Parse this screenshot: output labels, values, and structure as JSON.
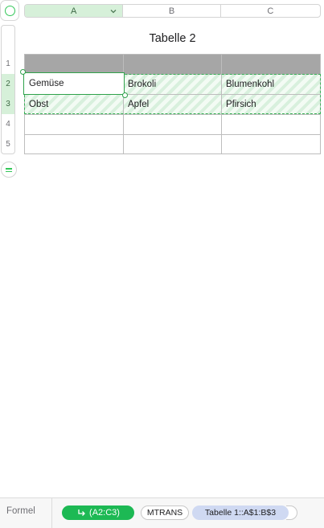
{
  "columns": [
    {
      "label": "A",
      "selected": true
    },
    {
      "label": "B",
      "selected": false
    },
    {
      "label": "C",
      "selected": false
    }
  ],
  "rows": [
    "1",
    "2",
    "3",
    "4",
    "5"
  ],
  "selected_rows": [
    "2",
    "3"
  ],
  "table_title": "Tabelle 2",
  "cells": [
    [
      "",
      "",
      ""
    ],
    [
      "Gemüse",
      "Brokoli",
      "Blumenkohl"
    ],
    [
      "Obst",
      "Apfel",
      "Pfirsich"
    ],
    [
      "",
      "",
      ""
    ],
    [
      "",
      "",
      ""
    ]
  ],
  "formula_bar": {
    "label": "Formel",
    "result_token": "(A2:C3)",
    "function_token": "MTRANS",
    "argument_token": "Tabelle 1::A$1:B$3"
  },
  "colors": {
    "accent": "#34c759",
    "header_fill": "#a6a6a6",
    "argument_token": "#cfd9f2"
  },
  "icons": [
    "select-all-icon",
    "chevron-down-icon",
    "add-row-icon",
    "arrow-return-icon"
  ]
}
